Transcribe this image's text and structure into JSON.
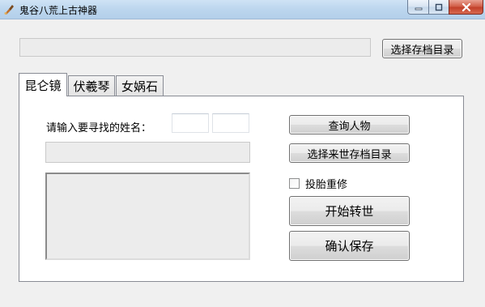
{
  "window": {
    "title": "鬼谷八荒上古神器",
    "icon": "tool-brush-icon"
  },
  "top": {
    "select_dir_label": "选择存档目录",
    "path_value": ""
  },
  "tabs": [
    {
      "label": "昆仑镜",
      "active": true
    },
    {
      "label": "伏羲琴",
      "active": false
    },
    {
      "label": "女娲石",
      "active": false
    }
  ],
  "panel": {
    "name_label": "请输入要寻找的姓名：",
    "name_part1": "",
    "name_part2": "",
    "result_value": "",
    "query_button": "查询人物",
    "next_dir_button": "选择来世存档目录",
    "reincarnate_checkbox": {
      "label": "投胎重修",
      "checked": false
    },
    "start_button": "开始转世",
    "save_button": "确认保存"
  },
  "colors": {
    "titlebar": "#bcd6ee",
    "close": "#c2402a",
    "panel": "#ffffff",
    "window": "#f0f0f0"
  }
}
